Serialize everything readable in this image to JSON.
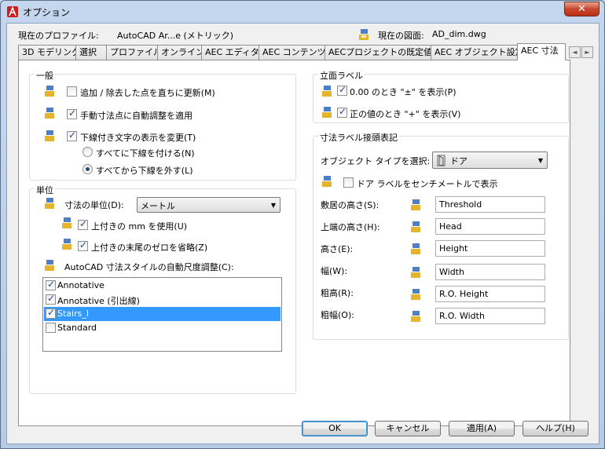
{
  "window": {
    "title": "オプション",
    "close_label": "✕"
  },
  "profile": {
    "label": "現在のプロファイル:",
    "value": "AutoCAD Ar...e (メトリック)",
    "drawing_label": "現在の図面:",
    "drawing_value": "AD_dim.dwg"
  },
  "tabs": [
    {
      "label": "3D モデリング"
    },
    {
      "label": "選択"
    },
    {
      "label": "プロファイル"
    },
    {
      "label": "オンライン"
    },
    {
      "label": "AEC エディタ"
    },
    {
      "label": "AEC コンテンツ"
    },
    {
      "label": "AECプロジェクトの既定値"
    },
    {
      "label": "AEC オブジェクト設定"
    },
    {
      "label": "AEC 寸法"
    }
  ],
  "tab_scroll": {
    "left": "◄",
    "right": "►"
  },
  "general": {
    "title": "一般",
    "update_on_add_remove": {
      "label": "追加 / 除去した点を直ちに更新(M)",
      "checked": false
    },
    "auto_adjust_manual": {
      "label": "手動寸法点に自動調整を適用",
      "checked": true
    },
    "underline_change": {
      "label": "下線付き文字の表示を変更(T)",
      "checked": true
    },
    "underline_all": {
      "label": "すべてに下線を付ける(N)",
      "selected": false
    },
    "underline_none": {
      "label": "すべてから下線を外す(L)",
      "selected": true
    }
  },
  "units": {
    "title": "単位",
    "dim_units_label": "寸法の単位(D):",
    "dim_units_value": "メートル",
    "use_mm_superscript": {
      "label": "上付きの mm を使用(U)",
      "checked": true
    },
    "suppress_trailing_zero": {
      "label": "上付きの末尾のゼロを省略(Z)",
      "checked": true
    },
    "autoscale_label": "AutoCAD 寸法スタイルの自動尺度調整(C):",
    "styles": [
      {
        "label": "Annotative",
        "checked": true,
        "selected": false
      },
      {
        "label": "Annotative (引出線)",
        "checked": true,
        "selected": false
      },
      {
        "label": "Stairs_I",
        "checked": true,
        "selected": true
      },
      {
        "label": "Standard",
        "checked": false,
        "selected": false
      }
    ]
  },
  "elevation": {
    "title": "立面ラベル",
    "show_pm_zero": {
      "label": "0.00 のとき \"±\" を表示(P)",
      "checked": true
    },
    "show_plus_positive": {
      "label": "正の値のとき \"+\" を表示(V)",
      "checked": true
    }
  },
  "dim_prefix": {
    "title": "寸法ラベル接頭表記",
    "object_type_label": "オブジェクト タイプを選択:",
    "object_type_value": "ドア",
    "door_label_cm": {
      "label": "ドア ラベルをセンチメートルで表示",
      "checked": false
    },
    "fields": [
      {
        "label": "敷居の高さ(S):",
        "value": "Threshold"
      },
      {
        "label": "上端の高さ(H):",
        "value": "Head"
      },
      {
        "label": "高さ(E):",
        "value": "Height"
      },
      {
        "label": "幅(W):",
        "value": "Width"
      },
      {
        "label": "粗高(R):",
        "value": "R.O. Height"
      },
      {
        "label": "粗幅(O):",
        "value": "R.O. Width"
      }
    ]
  },
  "buttons": {
    "ok": "OK",
    "cancel": "キャンセル",
    "apply": "適用(A)",
    "help": "ヘルプ(H)"
  }
}
